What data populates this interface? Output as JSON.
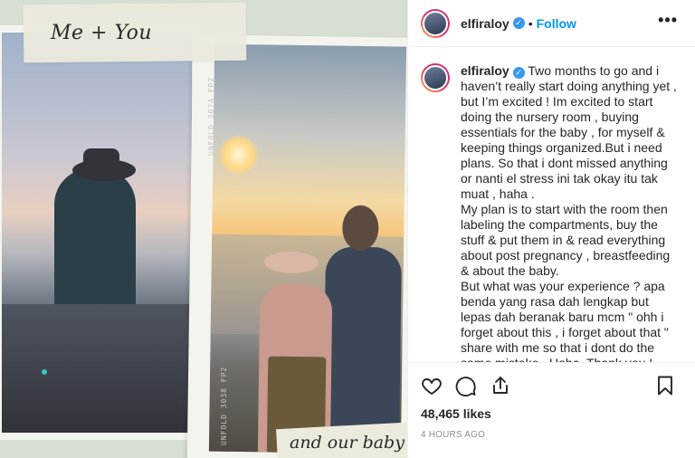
{
  "photo": {
    "tape_text": "Me + You",
    "bottom_tape_text": "and our baby",
    "film_label_top": "UNFOLD 3074 FP2",
    "film_label_bottom": "UNFOLD 3038 FP2"
  },
  "post": {
    "username": "elfiraloy",
    "verified_mark": "✓",
    "separator": "•",
    "follow_label": "Follow",
    "more_label": "•••",
    "caption": "Two months to go and i haven’t really start doing anything yet , but I’m excited ! Im excited to start doing the nursery room , buying essentials for the baby , for myself & keeping things organized.But i need plans. So that i dont missed anything or nanti el stress ini tak okay itu tak muat , haha .\nMy plan is to start with the room then labeling the compartments, buy the stuff & put them in & read everything about post pregnancy , breastfeeding & about the baby.\nBut what was your experience ? apa benda yang rasa dah lengkap but lepas dah beranak baru mcm \" ohh i forget about this , i forget about that \" share with me so that i dont do the same mistake . Haha. Thank you !",
    "likes": "48,465 likes",
    "time": "4 HOURS AGO"
  },
  "icons": {
    "like": "heart-icon",
    "comment": "comment-icon",
    "share": "share-icon",
    "save": "bookmark-icon"
  }
}
